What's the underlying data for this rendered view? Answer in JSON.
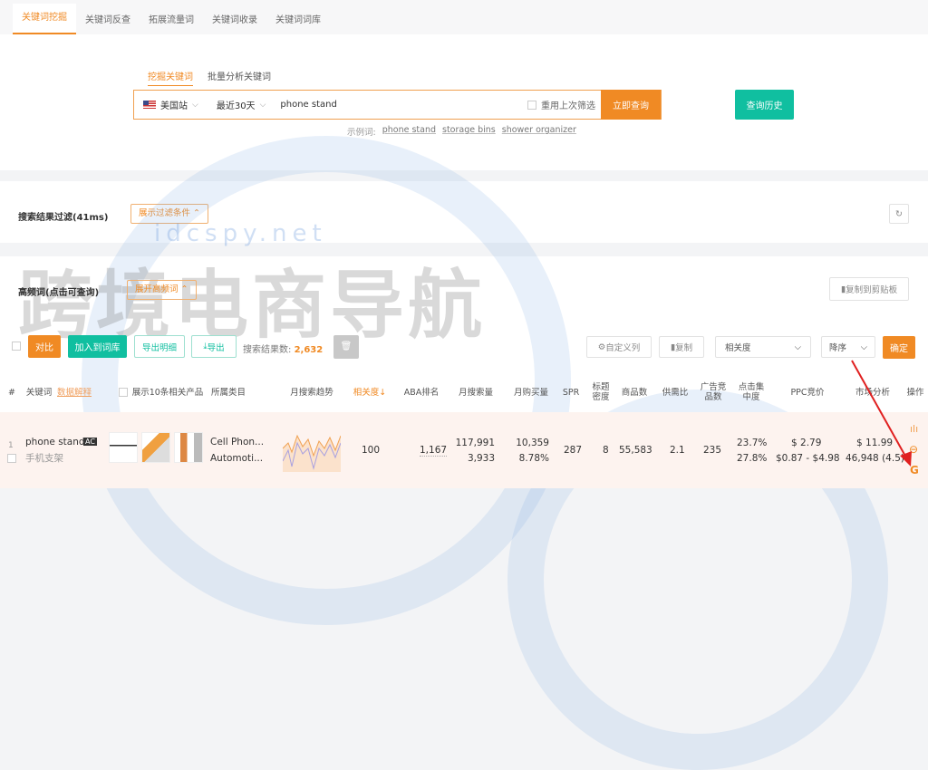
{
  "tabs": [
    "关键词挖掘",
    "关键词反查",
    "拓展流量词",
    "关键词收录",
    "关键词词库"
  ],
  "search": {
    "subtabs": [
      "挖掘关键词",
      "批量分析关键词"
    ],
    "site": "美国站",
    "period": "最近30天",
    "keyword": "phone stand",
    "reuse": "重用上次筛选",
    "submit": "立即查询",
    "history": "查询历史",
    "examples_label": "示例词:",
    "examples": [
      "phone stand",
      "storage bins",
      "shower organizer"
    ]
  },
  "filter": {
    "title": "搜索结果过滤(41ms)",
    "toggle": "展示过滤条件"
  },
  "hf": {
    "title": "高频词(点击可查询)",
    "toggle": "展开高频词",
    "copy": "复制到剪贴板"
  },
  "toolbar": {
    "compare": "对比",
    "add": "加入到词库",
    "export_detail": "导出明细",
    "export": "导出",
    "count_label": "搜索结果数:",
    "count": "2,632",
    "custom_cols": "自定义列",
    "copy": "复制",
    "sort_field": "相关度",
    "sort_order": "降序",
    "confirm": "确定"
  },
  "columns": {
    "idx": "#",
    "keyword": "关键词",
    "help": "数据解释",
    "show10": "展示10条相关产品",
    "category": "所属类目",
    "trend": "月搜索趋势",
    "relevance": "相关度↓",
    "aba": "ABA排名",
    "search_vol": "月搜索量",
    "purchase": "月购买量",
    "spr": "SPR",
    "title_density": "标题密度",
    "products": "商品数",
    "supply_demand": "供需比",
    "ad_products": "广告竞品数",
    "click_conc": "点击集中度",
    "ppc": "PPC竞价",
    "market": "市场分析",
    "ops": "操作"
  },
  "rows": [
    {
      "idx": "1",
      "keyword": "phone stand",
      "badge": "AC",
      "translation": "手机支架",
      "category1": "Cell Phon...",
      "category2": "Automoti...",
      "relevance": "100",
      "aba": "1,167",
      "search_vol": "117,991",
      "search_vol_sub": "3,933",
      "purchase": "10,359",
      "purchase_rate": "8.78%",
      "spr": "287",
      "title_density": "8",
      "products": "55,583",
      "supply_demand": "2.1",
      "ad_products": "235",
      "click_conc": "23.7%",
      "click_conc_sub": "27.8%",
      "ppc": "$ 2.79",
      "ppc_range": "$0.87 - $4.98",
      "market_price": "$ 11.99",
      "market_sub": "46,948 (4.5)"
    }
  ],
  "watermark": {
    "text": "跨境电商导航",
    "site": "idcspy.net"
  },
  "colors": {
    "accent": "#f08a24",
    "green": "#10bfa0"
  }
}
